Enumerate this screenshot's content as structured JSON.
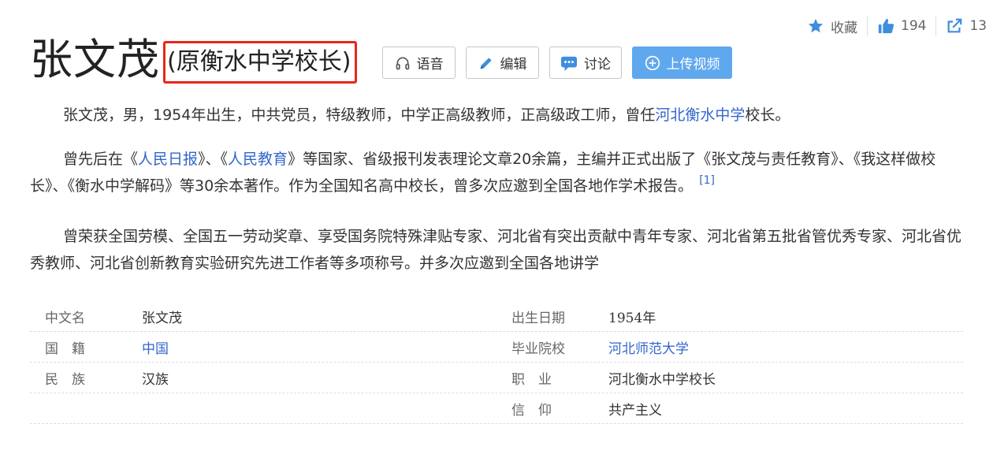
{
  "stats": {
    "favorite_label": "收藏",
    "like_count": "194",
    "share_count": "13"
  },
  "title": "张文茂",
  "subtitle": "(原衡水中学校长)",
  "buttons": {
    "voice": "语音",
    "edit": "编辑",
    "discuss": "讨论",
    "upload": "上传视频"
  },
  "paragraphs": {
    "p1_a": "张文茂，男，1954年出生，中共党员，特级教师，中学正高级教师，正高级政工师，曾任",
    "p1_link": "河北衡水中学",
    "p1_b": "校长。",
    "p2_a": "曾先后在《",
    "p2_link1": "人民日报",
    "p2_b": "》、《",
    "p2_link2": "人民教育",
    "p2_c": "》等国家、省级报刊发表理论文章20余篇，主编并正式出版了《张文茂与责任教育》、《我这样做校长》、《衡水中学解码》等30余本著作。作为全国知名高中校长，曾多次应邀到全国各地作学术报告。",
    "p2_ref": "[1]",
    "p3": "曾荣获全国劳模、全国五一劳动奖章、享受国务院特殊津贴专家、河北省有突出贡献中青年专家、河北省第五批省管优秀专家、河北省优秀教师、河北省创新教育实验研究先进工作者等多项称号。并多次应邀到全国各地讲学"
  },
  "info": {
    "rows": [
      {
        "l1": "中文名",
        "v1": "张文茂",
        "l2": "出生日期",
        "v2": "1954年"
      },
      {
        "l1": "国　籍",
        "v1": "中国",
        "l2": "毕业院校",
        "v2": "河北师范大学"
      },
      {
        "l1": "民　族",
        "v1": "汉族",
        "l2": "职　业",
        "v2": "河北衡水中学校长"
      },
      {
        "l1": "",
        "v1": "",
        "l2": "信　仰",
        "v2": "共产主义"
      }
    ]
  },
  "colors": {
    "link": "#3366cc",
    "highlight_border": "#e8261d",
    "upload_button": "#5fa8ee",
    "icon_blue": "#3e8ede"
  },
  "icons": [
    "star-icon",
    "thumbs-up-icon",
    "share-icon",
    "headphones-icon",
    "pencil-icon",
    "chat-icon",
    "plus-circle-icon"
  ]
}
